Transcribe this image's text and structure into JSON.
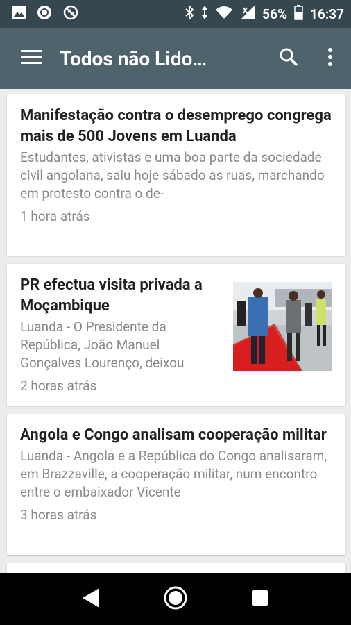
{
  "status": {
    "battery": "56%",
    "time": "16:37"
  },
  "appbar": {
    "title": "Todos não Lido…",
    "color": "#4f636c"
  },
  "articles": [
    {
      "title": "Manifestação contra o desemprego congrega mais de 500 Jovens em Luanda",
      "snippet": "Estudantes, ativistas e uma boa parte da sociedade civil angolana, saiu hoje sábado as ruas, marchando em protesto contra o de-",
      "time": "1 hora atrás"
    },
    {
      "title": "PR efectua visita privada a Moçambique",
      "snippet": "Luanda - O Presidente da República, João Manuel Gonçalves Lourenço, deixou",
      "time": "2 horas atrás",
      "image": "photo-president-walking-on-red-carpet"
    },
    {
      "title": "Angola e Congo analisam cooperação militar",
      "snippet": "Luanda - Angola e a República do Congo analisaram, em Brazzaville, a cooperação militar, num encontro entre o embaixador Vicente",
      "time": "3 horas atrás"
    }
  ]
}
